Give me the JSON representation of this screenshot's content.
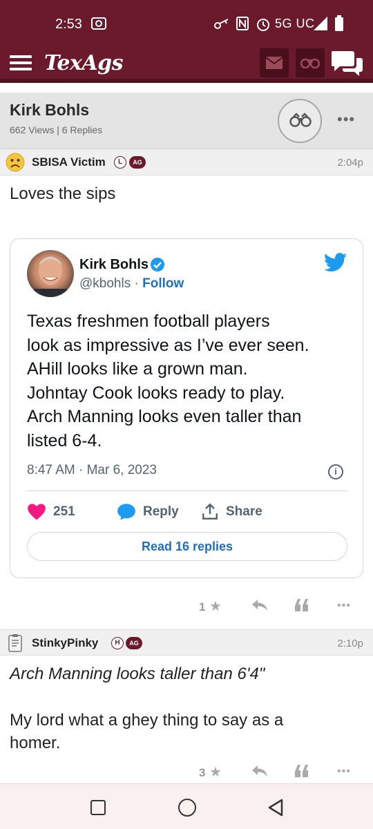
{
  "status_bar": {
    "time": "2:53",
    "network": "5G UC"
  },
  "app": {
    "logo": "TexAgs",
    "mail_icon": "mail-icon",
    "watch_icon": "binoculars-icon",
    "chat_icon": "chat-icon",
    "menu_icon": "hamburger-icon"
  },
  "thread": {
    "title": "Kirk Bohls",
    "meta": "662 Views | 6 Replies"
  },
  "posts": [
    {
      "user": "SBISA Victim",
      "badge_letter": "L",
      "badge_ag": "AG",
      "time": "2:04p",
      "body": "Loves the sips",
      "stars": "1"
    },
    {
      "user": "StinkyPinky",
      "badge_letter": "H",
      "badge_ag": "AG",
      "time": "2:10p",
      "quote": "Arch Manning looks taller than 6'4\"",
      "body_line1": "My lord what a ghey thing to say as a",
      "body_line2": "homer.",
      "stars": "3"
    }
  ],
  "tweet": {
    "name": "Kirk Bohls",
    "handle": "@kbohls",
    "separator": " · ",
    "follow": "Follow",
    "lines": [
      "Texas  freshmen football players",
      "look as impressive as I’ve ever seen.",
      "AHill looks like a grown man.",
      "Johntay Cook looks ready to play.",
      "Arch Manning looks even taller than",
      "listed 6-4."
    ],
    "date": "8:47 AM · Mar 6, 2023",
    "info": "i",
    "likes": "251",
    "reply": "Reply",
    "share": "Share",
    "read_replies": "Read 16 replies"
  },
  "colors": {
    "brand": "#6b1a2c",
    "twitter_blue": "#1d9bf0",
    "like_pink": "#f91880"
  }
}
